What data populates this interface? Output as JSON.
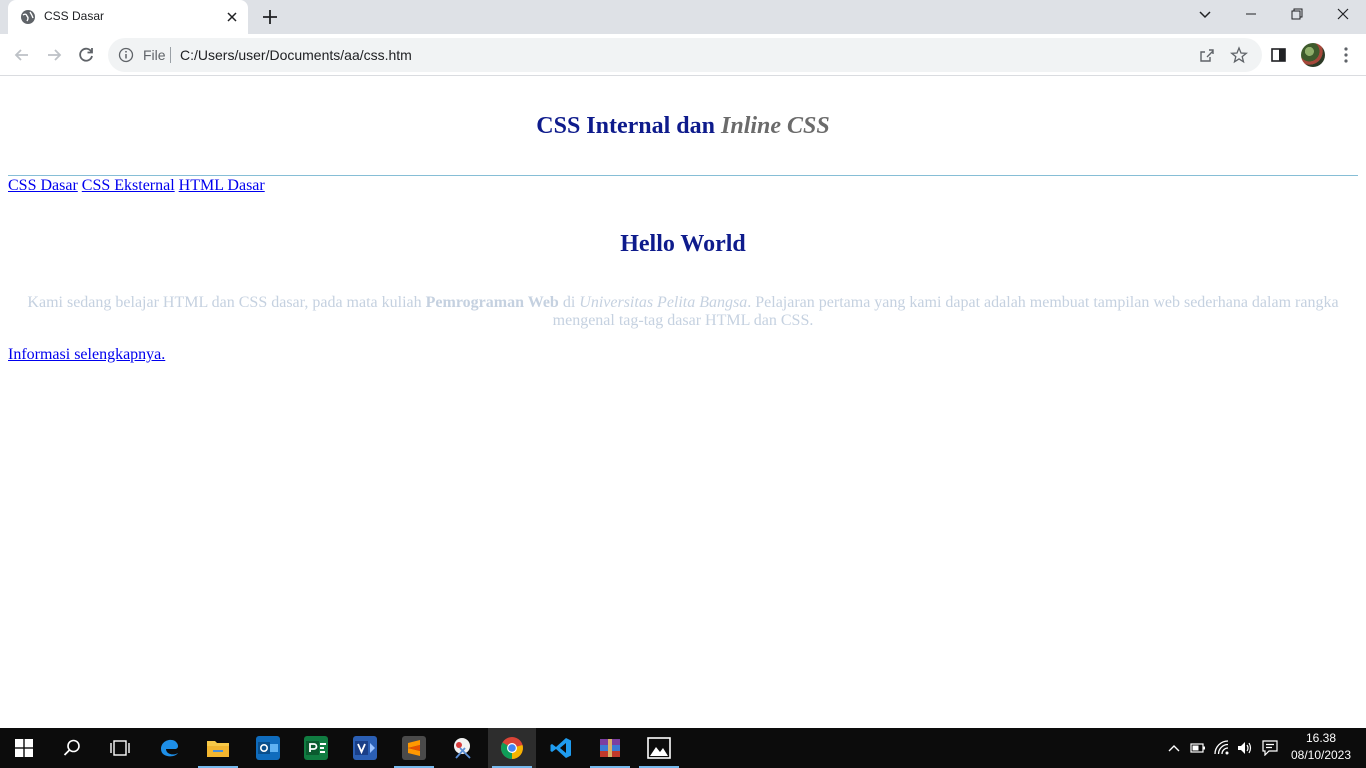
{
  "browser": {
    "tab": {
      "title": "CSS Dasar"
    },
    "omnibox": {
      "scheme_label": "File",
      "url": "C:/Users/user/Documents/aa/css.htm"
    }
  },
  "page": {
    "heading": {
      "main": "CSS Internal dan ",
      "emphasis": "Inline CSS"
    },
    "nav_links": [
      "CSS Dasar",
      "CSS Eksternal",
      "HTML Dasar"
    ],
    "hello": "Hello World",
    "paragraph": {
      "part1": "Kami sedang belajar HTML dan CSS dasar, pada mata kuliah ",
      "bold": "Pemrograman Web",
      "part2": " di ",
      "italic": "Universitas Pelita Bangsa",
      "part3": ". Pelajaran pertama yang kami dapat adalah membuat tampilan web sederhana dalam rangka mengenal tag-tag dasar HTML dan CSS."
    },
    "more_info_link": "Informasi selengkapnya."
  },
  "taskbar": {
    "apps": [
      "start",
      "search",
      "task-view",
      "edge",
      "file-explorer",
      "outlook",
      "project",
      "visio",
      "sublime-text",
      "snipping-tool",
      "chrome",
      "vscode",
      "winrar",
      "photos"
    ],
    "active_app": "chrome",
    "clock": {
      "time": "16.38",
      "date": "08/10/2023"
    }
  },
  "colors": {
    "heading": "#0e1b8c",
    "heading_emphasis": "#6b6b6b",
    "paragraph": "#c5d1e0",
    "link": "#0000ee",
    "rule": "#86bed6"
  }
}
